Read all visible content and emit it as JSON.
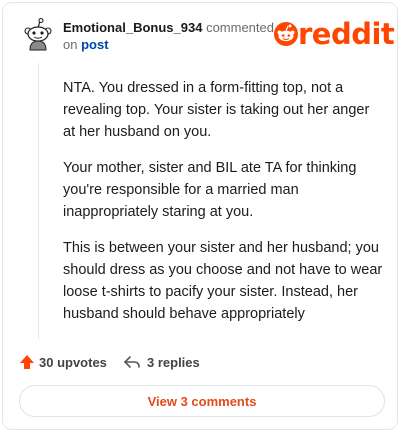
{
  "comment": {
    "username": "Emotional_Bonus_934",
    "commented_text": "commented",
    "on_text": "on",
    "post_link_text": "post",
    "paragraphs": [
      "NTA. You dressed in a form-fitting top, not a revealing top. Your sister is taking out her anger at her husband on you.",
      "Your mother, sister and BIL ate TA for thinking you're responsible for a married man inappropriately staring at you.",
      "This is between your sister and her husband; you should dress as you choose and not have to wear loose t-shirts to pacify your sister. Instead, her husband should behave appropriately"
    ]
  },
  "brand": {
    "logo_text": "reddit",
    "logo_icon": "reddit-snoo-icon",
    "color": "#ff4500"
  },
  "actions": {
    "upvotes_label": "30 upvotes",
    "upvote_icon": "upvote-arrow-icon",
    "replies_label": "3 replies",
    "reply_icon": "reply-arrow-icon"
  },
  "view_comments_label": "View 3 comments",
  "colors": {
    "accent": "#ff4500",
    "link": "#0045ac",
    "button_text": "#e54a1a"
  }
}
